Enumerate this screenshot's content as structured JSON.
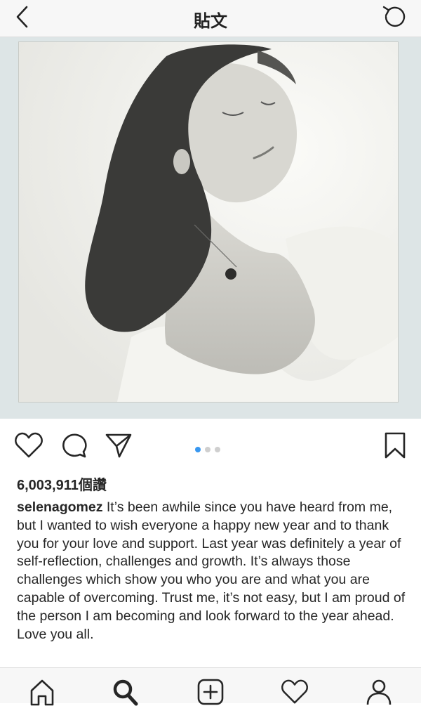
{
  "header": {
    "title": "貼文"
  },
  "post": {
    "image_alt": "Polaroid black and white portrait",
    "carousel": {
      "total": 3,
      "active": 1
    },
    "likes": "6,003,911個讚",
    "username": "selenagomez",
    "caption": "It’s been awhile since you have heard from me, but I wanted to wish everyone a happy new year and to thank you for your love and support. Last year was definitely a year of self-reflection, challenges and growth. It’s always those challenges which show you who you are and what you are capable of overcoming. Trust me, it’s not easy, but I am proud of the person I am becoming and look forward to the year ahead. Love you all."
  },
  "colors": {
    "accent": "#3897f0",
    "text": "#262626",
    "bar": "#f7f7f7"
  },
  "icons": {
    "header": [
      "back-arrow-icon",
      "refresh-icon"
    ],
    "actions": [
      "heart-icon",
      "comment-icon",
      "share-icon",
      "bookmark-icon"
    ],
    "nav": [
      "home-icon",
      "search-icon",
      "add-post-icon",
      "activity-heart-icon",
      "profile-icon"
    ]
  }
}
